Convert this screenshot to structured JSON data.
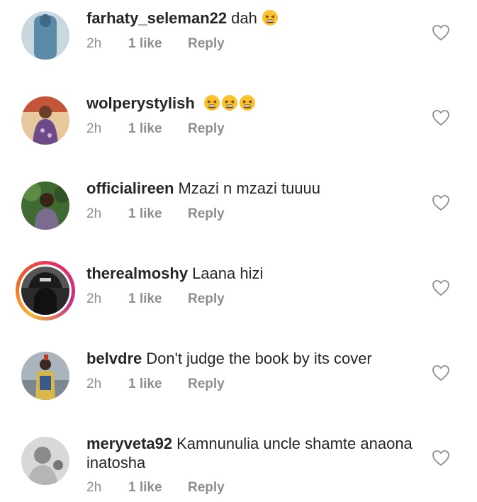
{
  "comments": [
    {
      "username": "farhaty_seleman22",
      "text": "dah",
      "emojis": 1,
      "time": "2h",
      "likes": "1 like",
      "reply": "Reply",
      "avatar_color": "#5a8aa8",
      "ring": false
    },
    {
      "username": "wolperystylish",
      "text": "",
      "emojis": 3,
      "time": "2h",
      "likes": "1 like",
      "reply": "Reply",
      "avatar_color": "#8b5a8c",
      "ring": false
    },
    {
      "username": "officialireen",
      "text": "Mzazi n mzazi tuuuu",
      "emojis": 0,
      "time": "2h",
      "likes": "1 like",
      "reply": "Reply",
      "avatar_color": "#3f6b32",
      "ring": false
    },
    {
      "username": "therealmoshy",
      "text": "Laana hizi",
      "emojis": 0,
      "time": "2h",
      "likes": "1 like",
      "reply": "Reply",
      "avatar_color": "#222222",
      "ring": true
    },
    {
      "username": "belvdre",
      "text": "Don't judge the book by its cover",
      "emojis": 0,
      "time": "2h",
      "likes": "1 like",
      "reply": "Reply",
      "avatar_color": "#6f7a86",
      "ring": false
    },
    {
      "username": "meryveta92",
      "text": "Kamnunulia uncle shamte anaona inatosha",
      "emojis": 0,
      "time": "2h",
      "likes": "1 like",
      "reply": "Reply",
      "avatar_color": "#9a9a9a",
      "ring": false
    }
  ],
  "icons": {
    "like": "heart-outline-icon",
    "emoji": "persevering-face-emoji"
  }
}
